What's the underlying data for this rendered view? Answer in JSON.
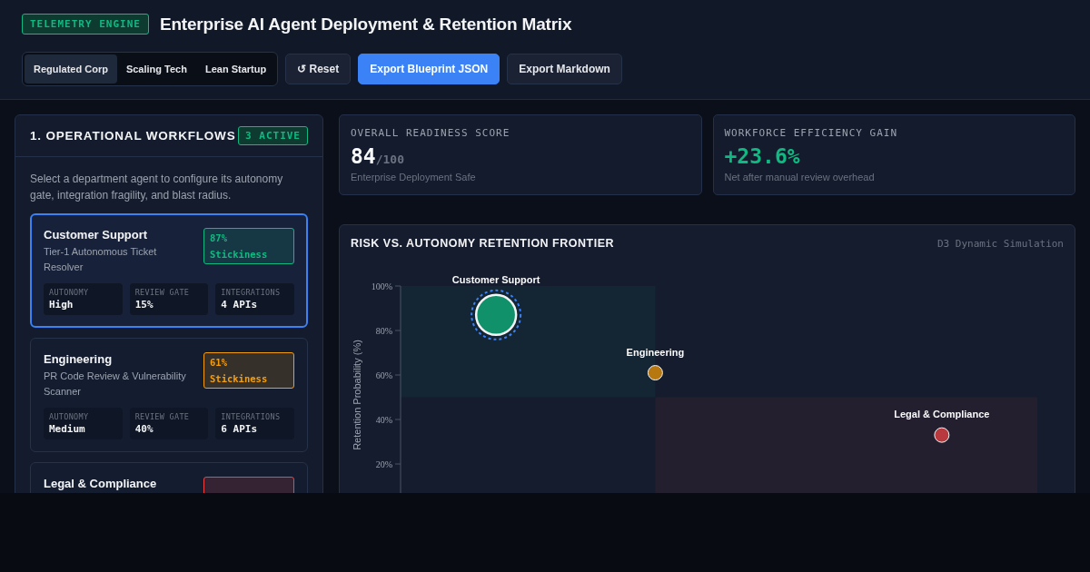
{
  "header": {
    "badge": "TELEMETRY ENGINE",
    "title": "Enterprise AI Agent Deployment & Retention Matrix"
  },
  "presets": [
    {
      "label": "Regulated Corp",
      "selected": true
    },
    {
      "label": "Scaling Tech",
      "selected": false
    },
    {
      "label": "Lean Startup",
      "selected": false
    }
  ],
  "actions": [
    {
      "label": "↺ Reset",
      "kind": "secondary"
    },
    {
      "label": "Export Blueprint JSON",
      "kind": "primary"
    },
    {
      "label": "Export Markdown",
      "kind": "secondary"
    }
  ],
  "workflows": {
    "title": "1. OPERATIONAL WORKFLOWS",
    "count": "3 ACTIVE",
    "description": "Select a department agent to configure its autonomy gate, integration fragility, and blast radius.",
    "cards": [
      {
        "name": "Customer Support",
        "subtitle": "Tier-1 Autonomous Ticket Resolver",
        "badge": "87% Stickiness",
        "color": "#10b981",
        "selected": true,
        "metrics": [
          {
            "label": "AUTONOMY",
            "value": "High"
          },
          {
            "label": "REVIEW GATE",
            "value": "15%"
          },
          {
            "label": "INTEGRATIONS",
            "value": "4 APIs"
          }
        ]
      },
      {
        "name": "Engineering",
        "subtitle": "PR Code Review & Vulnerability Scanner",
        "badge": "61% Stickiness",
        "color": "#f59e0b",
        "selected": false,
        "metrics": [
          {
            "label": "AUTONOMY",
            "value": "Medium"
          },
          {
            "label": "REVIEW GATE",
            "value": "40%"
          },
          {
            "label": "INTEGRATIONS",
            "value": "6 APIs"
          }
        ]
      },
      {
        "name": "Legal & Compliance",
        "color": "#ef4444",
        "selected": false
      }
    ]
  },
  "stats": [
    {
      "label": "OVERALL READINESS SCORE",
      "value": "84",
      "suffix": "/100",
      "note": "Enterprise Deployment Safe",
      "kind": "score"
    },
    {
      "label": "WORKFORCE EFFICIENCY GAIN",
      "value": "+23.6%",
      "note": "Net after manual review overhead",
      "kind": "gain"
    }
  ],
  "frontier": {
    "title": "RISK VS. AUTONOMY RETENTION FRONTIER",
    "tag": "D3 Dynamic Simulation",
    "axis_title": "Retention Probability (%)",
    "tick_labels": [
      "100%",
      "80%",
      "60%",
      "40%",
      "20%"
    ],
    "points": [
      {
        "label": "Customer Support",
        "color": "#10916a"
      },
      {
        "label": "Engineering",
        "color": "#b7790f"
      },
      {
        "label": "Legal & Compliance",
        "color": "#b83a3e"
      }
    ]
  }
}
